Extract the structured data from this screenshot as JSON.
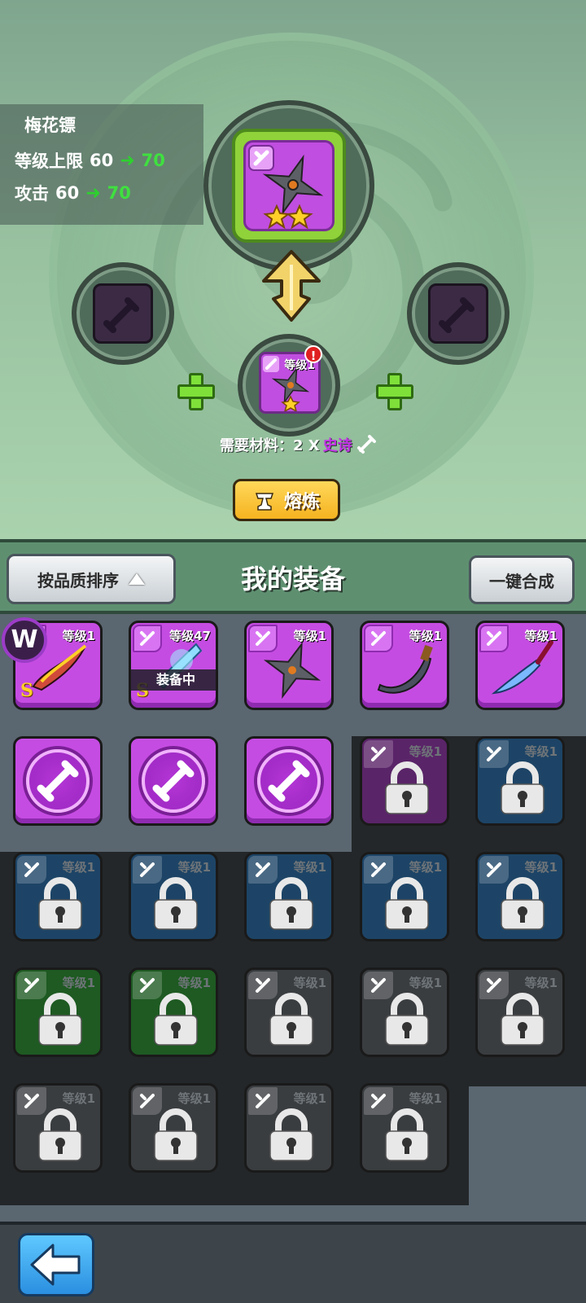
{
  "forge": {
    "item_name": "梅花镖",
    "level_cap_label": "等级上限",
    "level_cap_from": "60",
    "level_cap_to": "70",
    "attack_label": "攻击",
    "attack_from": "60",
    "attack_to": "70",
    "arrow": "➜",
    "main_stars": 2,
    "material_slot": {
      "level_label": "等级1",
      "badge": "!"
    },
    "need_label": "需要材料：2 X",
    "need_quality": "史诗",
    "smelt_label": "熔炼"
  },
  "header": {
    "sort_label": "按品质排序",
    "title": "我的装备",
    "merge_label": "一键合成"
  },
  "avatar_letter": "W",
  "equipment": [
    {
      "level": "等级1",
      "state": "purple",
      "rank": "S",
      "icon": "scythe-icon"
    },
    {
      "level": "等级47",
      "state": "purple",
      "rank": "S",
      "icon": "ice-blade-icon",
      "equipped": "装备中"
    },
    {
      "level": "等级1",
      "state": "purple",
      "icon": "shuriken-icon"
    },
    {
      "level": "等级1",
      "state": "purple",
      "icon": "curved-blade-icon"
    },
    {
      "level": "等级1",
      "state": "purple",
      "icon": "glaive-icon"
    },
    {
      "state": "material",
      "icon": "material-ring-icon"
    },
    {
      "state": "material",
      "icon": "material-ring-icon"
    },
    {
      "state": "material",
      "icon": "material-ring-icon"
    },
    {
      "level": "等级1",
      "state": "locked-purple"
    },
    {
      "level": "等级1",
      "state": "locked-blue"
    },
    {
      "level": "等级1",
      "state": "locked-blue"
    },
    {
      "level": "等级1",
      "state": "locked-blue"
    },
    {
      "level": "等级1",
      "state": "locked-blue"
    },
    {
      "level": "等级1",
      "state": "locked-blue"
    },
    {
      "level": "等级1",
      "state": "locked-blue"
    },
    {
      "level": "等级1",
      "state": "locked-green"
    },
    {
      "level": "等级1",
      "state": "locked-green"
    },
    {
      "level": "等级1",
      "state": "locked-grey"
    },
    {
      "level": "等级1",
      "state": "locked-grey"
    },
    {
      "level": "等级1",
      "state": "locked-grey"
    },
    {
      "level": "等级1",
      "state": "locked-grey"
    },
    {
      "level": "等级1",
      "state": "locked-grey"
    },
    {
      "level": "等级1",
      "state": "locked-grey"
    },
    {
      "level": "等级1",
      "state": "locked-grey"
    }
  ],
  "colors": {
    "epic_purple": "#c54ce2",
    "upgrade_green": "#3fe03f",
    "smelt_yellow": "#f5b320",
    "back_blue": "#2a8fe0"
  }
}
